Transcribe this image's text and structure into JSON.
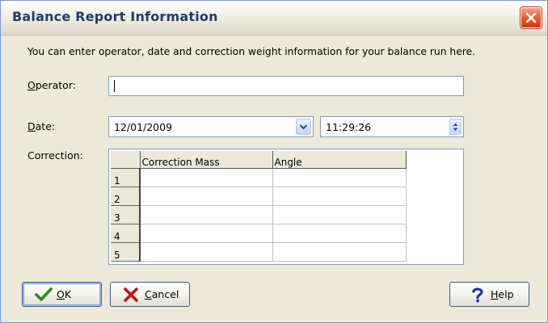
{
  "window": {
    "title": "Balance Report Information"
  },
  "intro_text": "You can enter operator, date and correction weight information for your balance run here.",
  "operator": {
    "label": "Operator:",
    "value": ""
  },
  "date": {
    "label": "Date:",
    "value": "12/01/2009",
    "time_value": "11:29:26"
  },
  "correction": {
    "label": "Correction:",
    "columns": [
      "Correction Mass",
      "Angle"
    ],
    "rows": [
      {
        "index": "1",
        "mass": "",
        "angle": ""
      },
      {
        "index": "2",
        "mass": "",
        "angle": ""
      },
      {
        "index": "3",
        "mass": "",
        "angle": ""
      },
      {
        "index": "4",
        "mass": "",
        "angle": ""
      },
      {
        "index": "5",
        "mass": "",
        "angle": ""
      }
    ]
  },
  "buttons": {
    "ok": "OK",
    "cancel": "Cancel",
    "help": "Help"
  },
  "icons": {
    "close": "close-icon",
    "ok": "checkmark-icon",
    "cancel": "x-icon",
    "help": "question-mark-icon",
    "dropdown": "chevron-down-icon",
    "spin": "spin-arrows-icon"
  },
  "colors": {
    "title_text": "#1f3c6e",
    "close_button": "#e15a30",
    "dialog_bg": "#ece9d8",
    "field_border": "#7f9db9"
  }
}
